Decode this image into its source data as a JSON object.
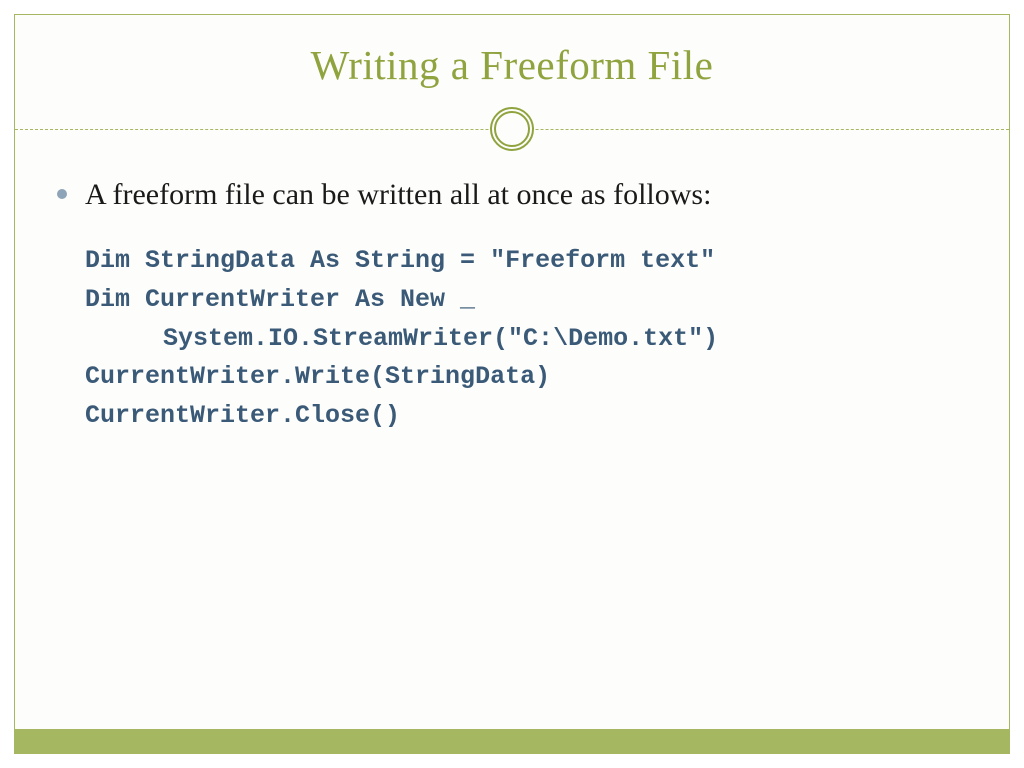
{
  "slide": {
    "title": "Writing a Freeform File",
    "bullet_text": "A freeform file can be written all at once as follows:",
    "code": {
      "line1": "Dim StringData As String = \"Freeform text\"",
      "line2": "Dim CurrentWriter As New _",
      "line3": "System.IO.StreamWriter(\"C:\\Demo.txt\")",
      "line4": "CurrentWriter.Write(StringData)",
      "line5": "CurrentWriter.Close()"
    }
  }
}
